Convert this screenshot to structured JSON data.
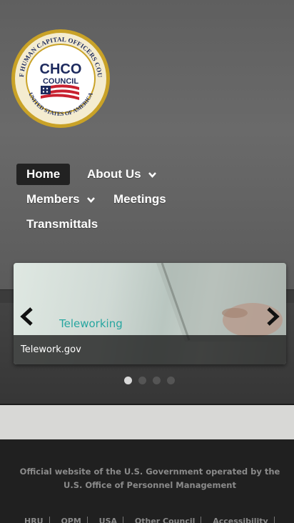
{
  "logo": {
    "ring_text_top": "CHIEF HUMAN CAPITAL OFFICERS COUNCIL",
    "ring_text_bottom": "UNITED STATES OF AMERICA",
    "center_line1": "CHCO",
    "center_line2": "COUNCIL"
  },
  "nav": {
    "items": [
      {
        "label": "Home",
        "active": true
      },
      {
        "label": "About Us",
        "has_dropdown": true
      },
      {
        "label": "Members",
        "has_dropdown": true
      },
      {
        "label": "Meetings"
      },
      {
        "label": "Transmittals"
      }
    ]
  },
  "slider": {
    "slide_title": "Teleworking",
    "slide_subtitle": "Telework.gov",
    "caption": "Telework.gov",
    "slide_count": 4,
    "active_slide": 1
  },
  "footer": {
    "official_text": "Official website of the U.S. Government operated by the U.S. Office of Personnel Management",
    "links": [
      "HRU",
      "OPM",
      "USA",
      "Other Council",
      "Accessibility"
    ]
  },
  "colors": {
    "header_bg": "#646464",
    "accent_teal": "#27a6a0",
    "footer_bg": "#202020"
  }
}
